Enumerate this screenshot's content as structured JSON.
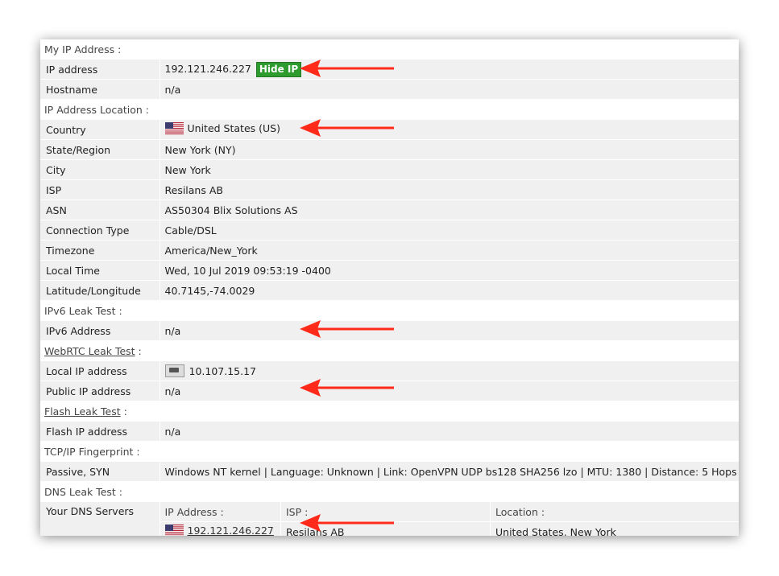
{
  "accent": "#2e9b2e",
  "arrow_color": "#ff2a1a",
  "sections": {
    "my_ip": "My IP Address :",
    "ip_location": "IP Address Location :",
    "ipv6_link": "IPv6 Leak Test",
    "webrtc_link": "WebRTC Leak Test",
    "flash_link": "Flash Leak Test",
    "tcpip": "TCP/IP Fingerprint :",
    "dns": "DNS Leak Test :",
    "colon": " :"
  },
  "ip": {
    "label": "IP address",
    "value": "192.121.246.227",
    "hide_button": "Hide IP"
  },
  "hostname": {
    "label": "Hostname",
    "value": "n/a"
  },
  "location": {
    "country_label": "Country",
    "country_value": "United States (US)",
    "state_label": "State/Region",
    "state_value": "New York (NY)",
    "city_label": "City",
    "city_value": "New York",
    "isp_label": "ISP",
    "isp_value": "Resilans AB",
    "asn_label": "ASN",
    "asn_value": "AS50304 Blix Solutions AS",
    "conn_label": "Connection Type",
    "conn_value": "Cable/DSL",
    "tz_label": "Timezone",
    "tz_value": "America/New_York",
    "time_label": "Local Time",
    "time_value": "Wed, 10 Jul 2019 09:53:19 -0400",
    "latlon_label": "Latitude/Longitude",
    "latlon_value": "40.7145,-74.0029"
  },
  "ipv6": {
    "label": "IPv6 Address",
    "value": "n/a"
  },
  "webrtc": {
    "local_label": "Local IP address",
    "local_value": "10.107.15.17",
    "public_label": "Public IP address",
    "public_value": "n/a"
  },
  "flash": {
    "label": "Flash IP address",
    "value": "n/a"
  },
  "tcp": {
    "label": "Passive, SYN",
    "value": "Windows NT kernel | Language: Unknown | Link: OpenVPN UDP bs128 SHA256 lzo | MTU: 1380 | Distance: 5 Hops"
  },
  "dns": {
    "label": "Your DNS Servers",
    "col_ip": "IP Address :",
    "col_isp": "ISP :",
    "col_location": "Location :",
    "rows": [
      {
        "ip": "192.121.246.227",
        "isp": "Resilans AB",
        "location": "United States, New York"
      }
    ]
  }
}
